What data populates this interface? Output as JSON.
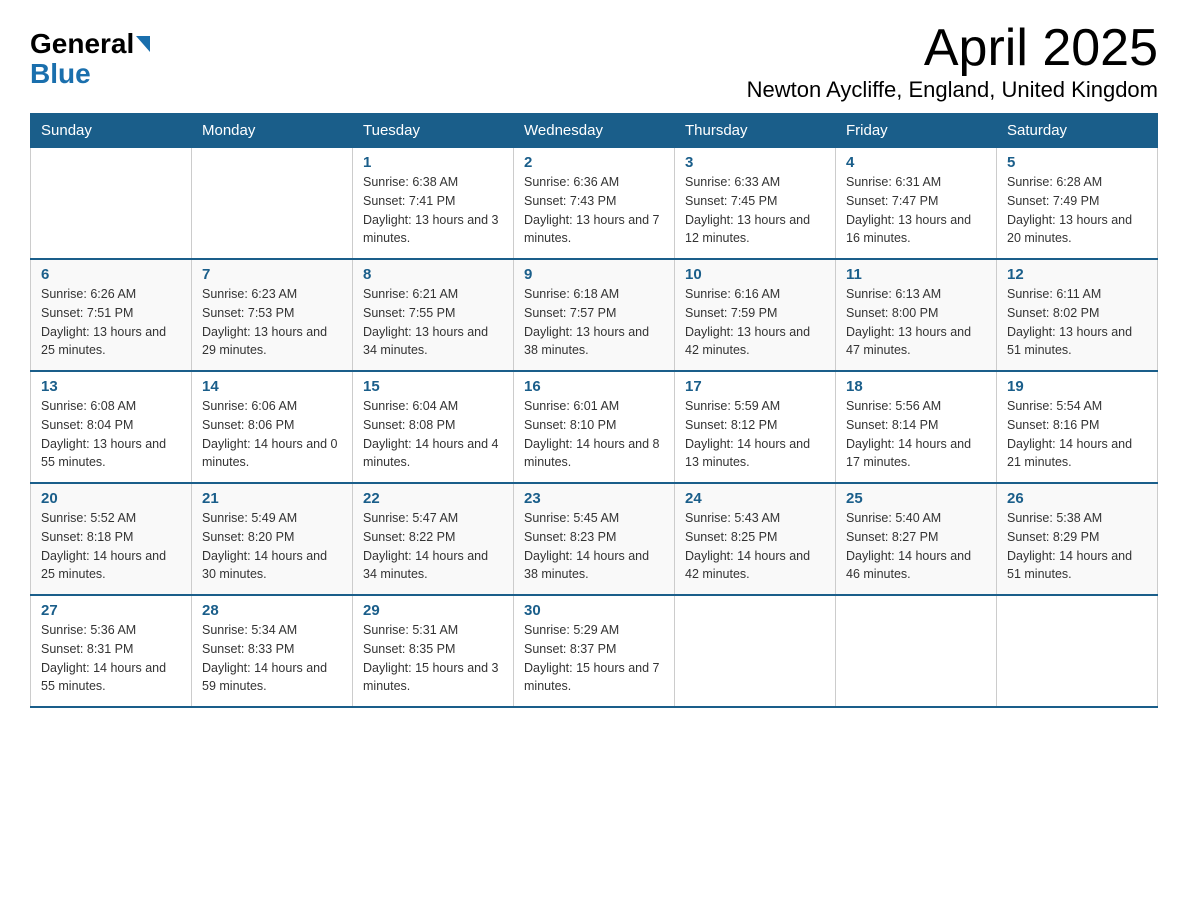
{
  "header": {
    "logo_general": "General",
    "logo_blue": "Blue",
    "month_title": "April 2025",
    "location": "Newton Aycliffe, England, United Kingdom"
  },
  "days_of_week": [
    "Sunday",
    "Monday",
    "Tuesday",
    "Wednesday",
    "Thursday",
    "Friday",
    "Saturday"
  ],
  "weeks": [
    [
      {
        "day": "",
        "sunrise": "",
        "sunset": "",
        "daylight": ""
      },
      {
        "day": "",
        "sunrise": "",
        "sunset": "",
        "daylight": ""
      },
      {
        "day": "1",
        "sunrise": "Sunrise: 6:38 AM",
        "sunset": "Sunset: 7:41 PM",
        "daylight": "Daylight: 13 hours and 3 minutes."
      },
      {
        "day": "2",
        "sunrise": "Sunrise: 6:36 AM",
        "sunset": "Sunset: 7:43 PM",
        "daylight": "Daylight: 13 hours and 7 minutes."
      },
      {
        "day": "3",
        "sunrise": "Sunrise: 6:33 AM",
        "sunset": "Sunset: 7:45 PM",
        "daylight": "Daylight: 13 hours and 12 minutes."
      },
      {
        "day": "4",
        "sunrise": "Sunrise: 6:31 AM",
        "sunset": "Sunset: 7:47 PM",
        "daylight": "Daylight: 13 hours and 16 minutes."
      },
      {
        "day": "5",
        "sunrise": "Sunrise: 6:28 AM",
        "sunset": "Sunset: 7:49 PM",
        "daylight": "Daylight: 13 hours and 20 minutes."
      }
    ],
    [
      {
        "day": "6",
        "sunrise": "Sunrise: 6:26 AM",
        "sunset": "Sunset: 7:51 PM",
        "daylight": "Daylight: 13 hours and 25 minutes."
      },
      {
        "day": "7",
        "sunrise": "Sunrise: 6:23 AM",
        "sunset": "Sunset: 7:53 PM",
        "daylight": "Daylight: 13 hours and 29 minutes."
      },
      {
        "day": "8",
        "sunrise": "Sunrise: 6:21 AM",
        "sunset": "Sunset: 7:55 PM",
        "daylight": "Daylight: 13 hours and 34 minutes."
      },
      {
        "day": "9",
        "sunrise": "Sunrise: 6:18 AM",
        "sunset": "Sunset: 7:57 PM",
        "daylight": "Daylight: 13 hours and 38 minutes."
      },
      {
        "day": "10",
        "sunrise": "Sunrise: 6:16 AM",
        "sunset": "Sunset: 7:59 PM",
        "daylight": "Daylight: 13 hours and 42 minutes."
      },
      {
        "day": "11",
        "sunrise": "Sunrise: 6:13 AM",
        "sunset": "Sunset: 8:00 PM",
        "daylight": "Daylight: 13 hours and 47 minutes."
      },
      {
        "day": "12",
        "sunrise": "Sunrise: 6:11 AM",
        "sunset": "Sunset: 8:02 PM",
        "daylight": "Daylight: 13 hours and 51 minutes."
      }
    ],
    [
      {
        "day": "13",
        "sunrise": "Sunrise: 6:08 AM",
        "sunset": "Sunset: 8:04 PM",
        "daylight": "Daylight: 13 hours and 55 minutes."
      },
      {
        "day": "14",
        "sunrise": "Sunrise: 6:06 AM",
        "sunset": "Sunset: 8:06 PM",
        "daylight": "Daylight: 14 hours and 0 minutes."
      },
      {
        "day": "15",
        "sunrise": "Sunrise: 6:04 AM",
        "sunset": "Sunset: 8:08 PM",
        "daylight": "Daylight: 14 hours and 4 minutes."
      },
      {
        "day": "16",
        "sunrise": "Sunrise: 6:01 AM",
        "sunset": "Sunset: 8:10 PM",
        "daylight": "Daylight: 14 hours and 8 minutes."
      },
      {
        "day": "17",
        "sunrise": "Sunrise: 5:59 AM",
        "sunset": "Sunset: 8:12 PM",
        "daylight": "Daylight: 14 hours and 13 minutes."
      },
      {
        "day": "18",
        "sunrise": "Sunrise: 5:56 AM",
        "sunset": "Sunset: 8:14 PM",
        "daylight": "Daylight: 14 hours and 17 minutes."
      },
      {
        "day": "19",
        "sunrise": "Sunrise: 5:54 AM",
        "sunset": "Sunset: 8:16 PM",
        "daylight": "Daylight: 14 hours and 21 minutes."
      }
    ],
    [
      {
        "day": "20",
        "sunrise": "Sunrise: 5:52 AM",
        "sunset": "Sunset: 8:18 PM",
        "daylight": "Daylight: 14 hours and 25 minutes."
      },
      {
        "day": "21",
        "sunrise": "Sunrise: 5:49 AM",
        "sunset": "Sunset: 8:20 PM",
        "daylight": "Daylight: 14 hours and 30 minutes."
      },
      {
        "day": "22",
        "sunrise": "Sunrise: 5:47 AM",
        "sunset": "Sunset: 8:22 PM",
        "daylight": "Daylight: 14 hours and 34 minutes."
      },
      {
        "day": "23",
        "sunrise": "Sunrise: 5:45 AM",
        "sunset": "Sunset: 8:23 PM",
        "daylight": "Daylight: 14 hours and 38 minutes."
      },
      {
        "day": "24",
        "sunrise": "Sunrise: 5:43 AM",
        "sunset": "Sunset: 8:25 PM",
        "daylight": "Daylight: 14 hours and 42 minutes."
      },
      {
        "day": "25",
        "sunrise": "Sunrise: 5:40 AM",
        "sunset": "Sunset: 8:27 PM",
        "daylight": "Daylight: 14 hours and 46 minutes."
      },
      {
        "day": "26",
        "sunrise": "Sunrise: 5:38 AM",
        "sunset": "Sunset: 8:29 PM",
        "daylight": "Daylight: 14 hours and 51 minutes."
      }
    ],
    [
      {
        "day": "27",
        "sunrise": "Sunrise: 5:36 AM",
        "sunset": "Sunset: 8:31 PM",
        "daylight": "Daylight: 14 hours and 55 minutes."
      },
      {
        "day": "28",
        "sunrise": "Sunrise: 5:34 AM",
        "sunset": "Sunset: 8:33 PM",
        "daylight": "Daylight: 14 hours and 59 minutes."
      },
      {
        "day": "29",
        "sunrise": "Sunrise: 5:31 AM",
        "sunset": "Sunset: 8:35 PM",
        "daylight": "Daylight: 15 hours and 3 minutes."
      },
      {
        "day": "30",
        "sunrise": "Sunrise: 5:29 AM",
        "sunset": "Sunset: 8:37 PM",
        "daylight": "Daylight: 15 hours and 7 minutes."
      },
      {
        "day": "",
        "sunrise": "",
        "sunset": "",
        "daylight": ""
      },
      {
        "day": "",
        "sunrise": "",
        "sunset": "",
        "daylight": ""
      },
      {
        "day": "",
        "sunrise": "",
        "sunset": "",
        "daylight": ""
      }
    ]
  ]
}
